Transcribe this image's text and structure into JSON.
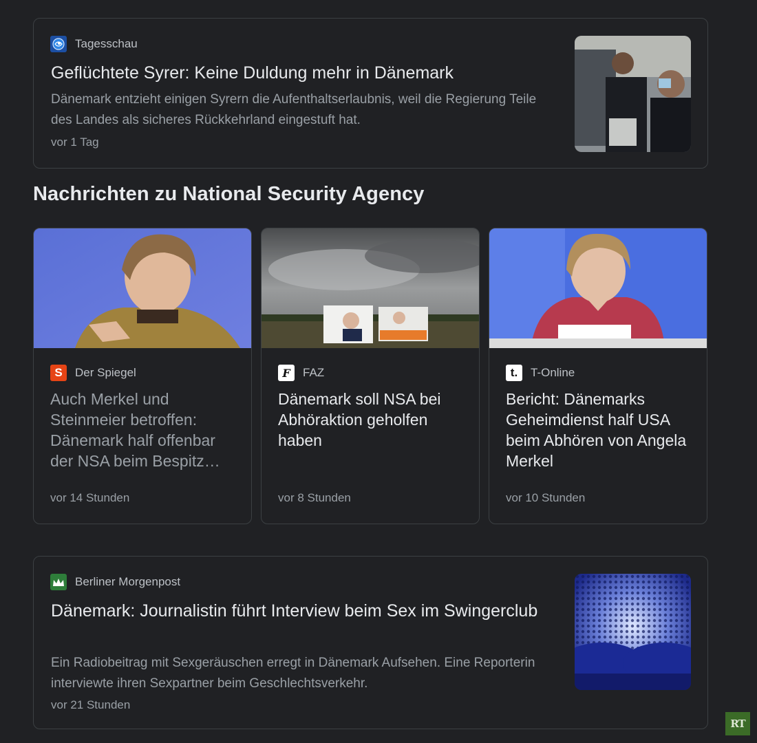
{
  "top_article": {
    "source": "Tagesschau",
    "favicon": "tagesschau-globe-icon",
    "headline": "Geflüchtete Syrer: Keine Duldung mehr in Dänemark",
    "snippet": "Dänemark entzieht einigen Syrern die Aufenthaltserlaubnis, weil die Regierung Teile des Landes als sicheres Rückkehrland eingestuft hat.",
    "time": "vor 1 Tag"
  },
  "section": {
    "title": "Nachrichten zu National Security Agency"
  },
  "grid_articles": [
    {
      "source": "Der Spiegel",
      "favicon_letter": "S",
      "headline": "Auch Merkel und Steinmeier betroffen: Dänemark half offenbar der NSA beim Bespitz…",
      "time": "vor 14 Stunden"
    },
    {
      "source": "FAZ",
      "favicon_letter": "F",
      "headline": "Dänemark soll NSA bei Abhöraktion geholfen haben",
      "time": "vor 8 Stunden"
    },
    {
      "source": "T-Online",
      "favicon_letter": "t.",
      "headline": "Bericht: Dänemarks Geheimdienst half USA beim Abhören von Angela Merkel",
      "time": "vor 10 Stunden"
    }
  ],
  "bottom_article": {
    "source": "Berliner Morgenpost",
    "favicon": "morgenpost-crown-icon",
    "headline": "Dänemark: Journalistin führt Interview beim Sex im Swingerclub",
    "snippet": "Ein Radiobeitrag mit Sexgeräuschen erregt in Dänemark Aufsehen. Eine Reporterin interviewte ihren Sexpartner beim Geschlechtsverkehr.",
    "time": "vor 21 Stunden"
  },
  "watermark": {
    "text": "RT"
  },
  "colors": {
    "background": "#202124",
    "border": "#3c4043",
    "text_primary": "#e8eaed",
    "text_secondary": "#9aa0a6",
    "spiegel": "#e64415",
    "rt": "#3b6b27"
  }
}
